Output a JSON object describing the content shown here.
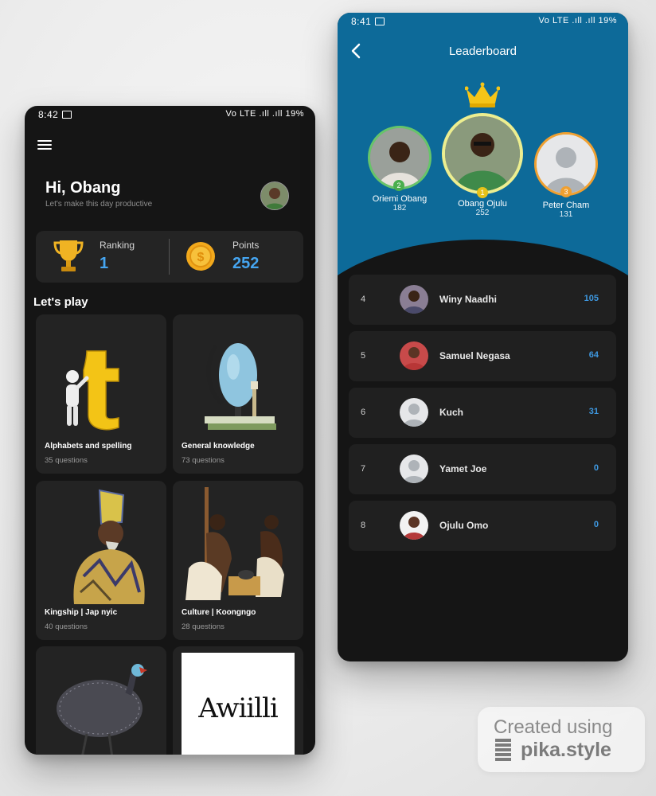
{
  "home": {
    "status": {
      "time": "8:42",
      "system": "Vo LTE .ıll .ıll 19%"
    },
    "greeting": "Hi, Obang",
    "subtitle": "Let's make this day productive",
    "stats": {
      "ranking_label": "Ranking",
      "ranking_value": "1",
      "points_label": "Points",
      "points_value": "252"
    },
    "section_title": "Let's play",
    "categories": [
      {
        "name": "Alphabets and spelling",
        "count": "35 questions"
      },
      {
        "name": "General knowledge",
        "count": "73 questions"
      },
      {
        "name": "Kingship | Jap nyic",
        "count": "40 questions"
      },
      {
        "name": "Culture | Koongngo",
        "count": "28 questions"
      },
      {
        "name": "",
        "count": ""
      },
      {
        "name": "",
        "count": "",
        "image_text": "Awiilli"
      }
    ]
  },
  "leaderboard": {
    "status": {
      "time": "8:41",
      "system": "Vo LTE .ıll .ıll 19%"
    },
    "title": "Leaderboard",
    "podium": [
      {
        "rank": "2",
        "name": "Oriemi Obang",
        "points": "182"
      },
      {
        "rank": "1",
        "name": "Obang Ojulu",
        "points": "252"
      },
      {
        "rank": "3",
        "name": "Peter Cham",
        "points": "131"
      }
    ],
    "list": [
      {
        "rank": "4",
        "name": "Winy Naadhi",
        "points": "105"
      },
      {
        "rank": "5",
        "name": "Samuel Negasa",
        "points": "64"
      },
      {
        "rank": "6",
        "name": "Kuch",
        "points": "31"
      },
      {
        "rank": "7",
        "name": "Yamet Joe",
        "points": "0"
      },
      {
        "rank": "8",
        "name": "Ojulu Omo",
        "points": "0"
      }
    ]
  },
  "credit": {
    "line1": "Created using",
    "line2": "pika.style"
  },
  "colors": {
    "accent_blue": "#45a5f0",
    "header_blue": "#0d6a99",
    "gold": "#f5c518",
    "rank2_green": "#67c56a",
    "rank3_orange": "#f0a030"
  }
}
